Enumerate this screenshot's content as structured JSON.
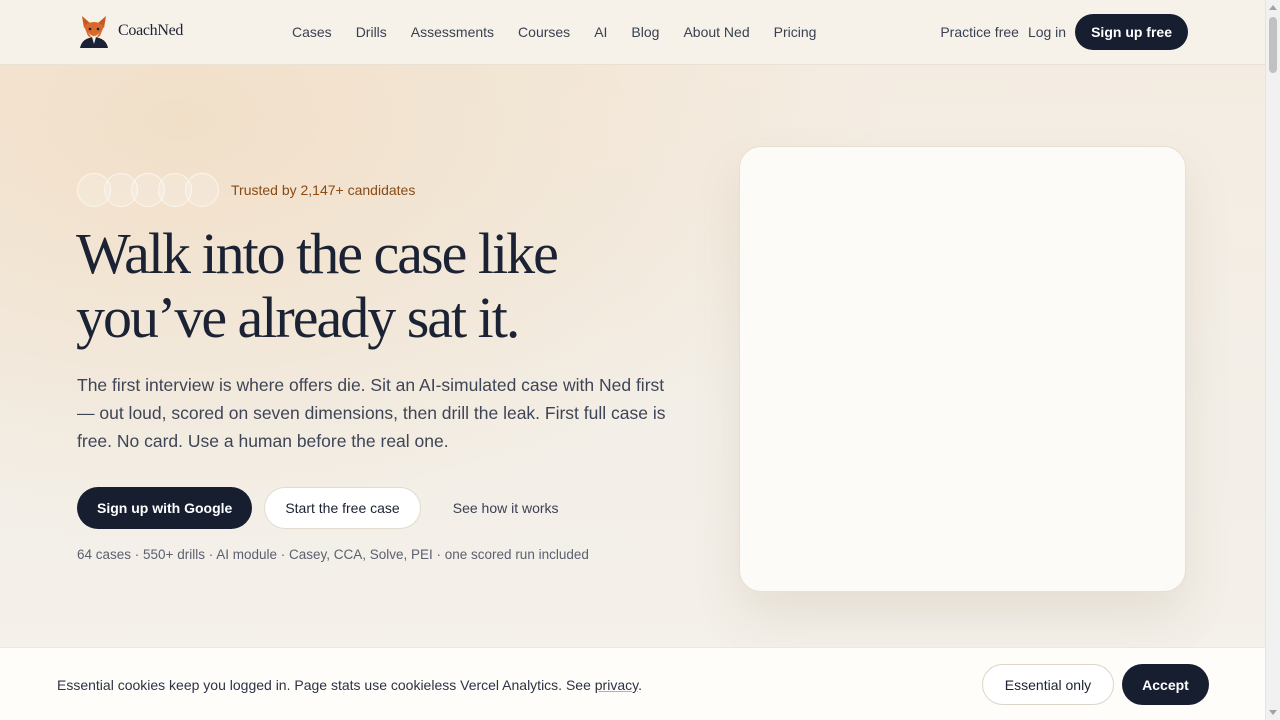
{
  "brand": {
    "name": "CoachNed",
    "logo_icon": "fox-in-suit-icon"
  },
  "nav": {
    "links": [
      "Cases",
      "Drills",
      "Assessments",
      "Courses",
      "AI",
      "Blog",
      "About Ned",
      "Pricing"
    ],
    "practice_free": "Practice free",
    "login": "Log in",
    "signup": "Sign up free"
  },
  "hero": {
    "trust_text": "Trusted by 2,147+ candidates",
    "avatar_count": 5,
    "headline": "Walk into the case like you’ve already sat it.",
    "lede": "The first interview is where offers die. Sit an AI-simulated case with Ned first — out loud, scored on seven dimensions, then drill the leak. First full case is free. No card. Use a human before the real one.",
    "cta_google": "Sign up with Google",
    "cta_free_case": "Start the free case",
    "cta_how": "See how it works",
    "meta": "64 cases · 550+ drills · AI module · Casey, CCA, Solve, PEI · one scored run included"
  },
  "cookie": {
    "text": "Essential cookies keep you logged in. Page stats use cookieless Vercel Analytics. See",
    "privacy_link": "privacy",
    "period": ".",
    "essential_only": "Essential only",
    "accept": "Accept"
  },
  "colors": {
    "primary_dark": "#161e30",
    "accent_brown": "#8a4a12",
    "background": "#f3ede3"
  }
}
